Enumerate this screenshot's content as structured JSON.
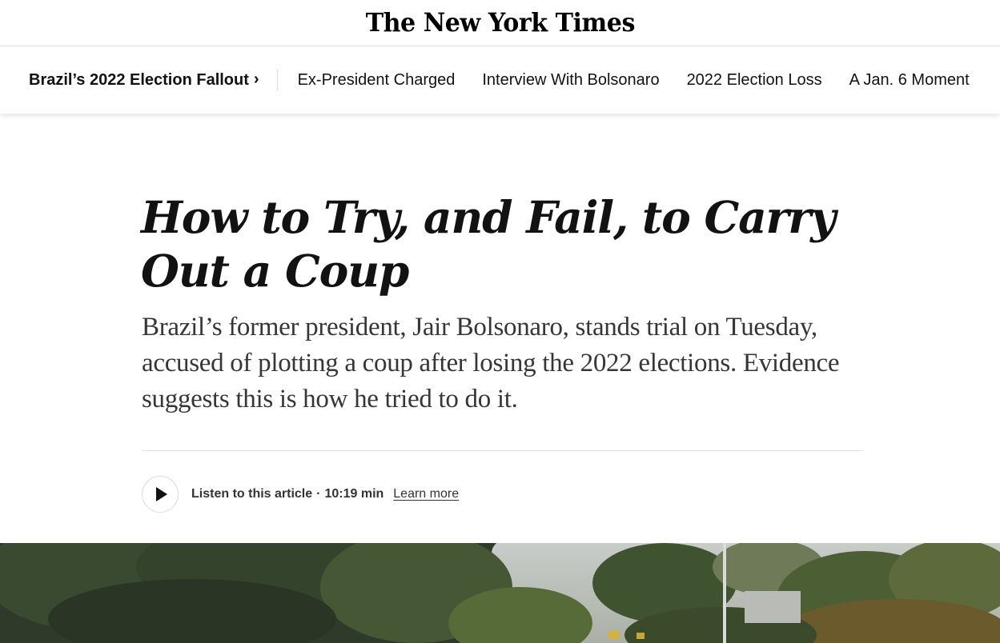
{
  "masthead": {
    "logo_text": "The New York Times"
  },
  "topic_nav": {
    "title": "Brazil’s 2022 Election Fallout",
    "chevron": "›",
    "links": [
      {
        "label": "Ex-President Charged"
      },
      {
        "label": "Interview With Bolsonaro"
      },
      {
        "label": "2022 Election Loss"
      },
      {
        "label": "A Jan. 6 Moment"
      }
    ]
  },
  "article": {
    "headline": "How to Try, and Fail, to Carry Out a Coup",
    "summary": "Brazil’s former president, Jair Bolsonaro, stands trial on Tuesday, accused of plotting a coup after losing the 2022 elections. Evidence suggests this is how he tried to do it."
  },
  "audio": {
    "label": "Listen to this article",
    "separator": "·",
    "duration": "10:19 min",
    "learn_more": "Learn more",
    "icon": "play-icon"
  },
  "colors": {
    "text": "#121212",
    "summary_text": "#363636",
    "rule": "#dfdfdf",
    "foliage_dark": "#2f3a2a",
    "foliage_mid": "#4c5e33"
  }
}
